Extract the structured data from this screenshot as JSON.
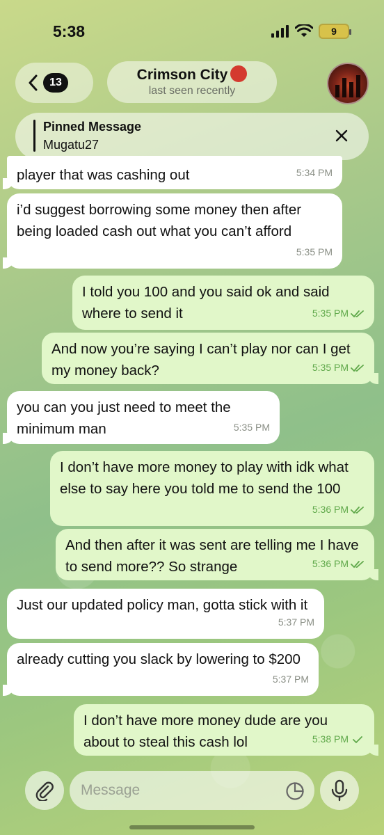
{
  "status_bar": {
    "time": "5:38",
    "battery": "9"
  },
  "header": {
    "back_count": "13",
    "title": "Crimson City",
    "subtitle": "last seen recently",
    "title_emoji": "angry-face-emoji"
  },
  "pinned": {
    "label": "Pinned Message",
    "text": "Mugatu27"
  },
  "messages": [
    {
      "dir": "in",
      "text": "player that was cashing out",
      "time": "5:34 PM"
    },
    {
      "dir": "in",
      "text": "i’d suggest borrowing some money then after being loaded cash out what you can’t afford",
      "time": "5:35 PM"
    },
    {
      "dir": "out",
      "text": "I told you 100 and you said ok and said where to send it",
      "time": "5:35 PM",
      "status": "read"
    },
    {
      "dir": "out",
      "text": "And now you’re saying I can’t play nor can I get my money back?",
      "time": "5:35 PM",
      "status": "read"
    },
    {
      "dir": "in",
      "text": "you can you just need to meet the minimum man",
      "time": "5:35 PM"
    },
    {
      "dir": "out",
      "text": "I don’t have more money to play with idk what else to say here you told me to send the 100",
      "time": "5:36 PM",
      "status": "read"
    },
    {
      "dir": "out",
      "text": "And then after it was sent are telling me I have to send more?? So strange",
      "time": "5:36 PM",
      "status": "read"
    },
    {
      "dir": "in",
      "text": "Just our updated policy man, gotta stick with it",
      "time": "5:37 PM"
    },
    {
      "dir": "in",
      "text": "already cutting you slack by lowering to $200",
      "time": "5:37 PM"
    },
    {
      "dir": "out",
      "text": "I don’t have more money dude are you about to steal this cash lol",
      "time": "5:38 PM",
      "status": "sent"
    }
  ],
  "composer": {
    "placeholder": "Message"
  },
  "colors": {
    "incoming_bubble": "#ffffff",
    "outgoing_bubble": "#e1f7c9",
    "check_green": "#5fa84a"
  }
}
